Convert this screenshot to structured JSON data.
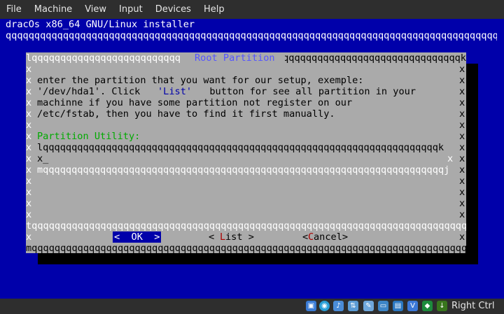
{
  "menu": {
    "items": [
      "File",
      "Machine",
      "View",
      "Input",
      "Devices",
      "Help"
    ]
  },
  "installer": {
    "backtitle": "dracOs x86_64 GNU/Linux installer",
    "rule": "qqqqqqqqqqqqqqqqqqqqqqqqqqqqqqqqqqqqqqqqqqqqqqqqqqqqqqqqqqqqqqqqqqqqqqqqqqqqqqqqqqqqqqqqqqqqq"
  },
  "dialog": {
    "title": "Root Partition",
    "border_top_left": "lqqqqqqqqqqqqqqqqqqqqqqqqqq",
    "border_top_right": "qqqqqqqqqqqqqqqqqqqqqqqqqqqqqqqqqqqqqqqqqqqqqqqqqqqqqqqqqqqqqqqqqqqqqqk",
    "side": "x",
    "message": [
      "enter the partition that you want for our setup, exemple:",
      "'/dev/hda1'. Click ",
      "machinne if you have some partition not register on our",
      "/etc/fstab, then you have to find it first manually."
    ],
    "list_word": "'List'",
    "message_line2_tail": "  button for see all partition in your",
    "section_label": "Partition Utility:",
    "input_top": "lqqqqqqqqqqqqqqqqqqqqqqqqqqqqqqqqqqqqqqqqqqqqqqqqqqqqqqqqqqqqqqqqqqqqqk",
    "input_value": "x_",
    "input_bottom": "mqqqqqqqqqqqqqqqqqqqqqqqqqqqqqqqqqqqqqqqqqqqqqqqqqqqqqqqqqqqqqqqqqqqqqqj",
    "separator": "tqqqqqqqqqqqqqqqqqqqqqqqqqqqqqqqqqqqqqqqqqqqqqqqqqqqqqqqqqqqqqqqqqqqqqqqqqqqqqqqqqqqqqqqqqqqu",
    "border_bottom": "mqqqqqqqqqqqqqqqqqqqqqqqqqqqqqqqqqqqqqqqqqqqqqqqqqqqqqqqqqqqqqqqqqqqqqqqqqqqqqqqqqqqqqqqqqqqj",
    "buttons": {
      "ok": "<  OK  >",
      "list_left": "< ",
      "list_hot": "L",
      "list_rest": "ist >",
      "cancel_left": "<",
      "cancel_hot": "C",
      "cancel_rest": "ancel>"
    }
  },
  "statusbar": {
    "host_key": "Right Ctrl"
  },
  "colors": {
    "screen": "#0000aa",
    "dialog": "#aaaaaa",
    "title": "#5555ff",
    "section": "#00aa00",
    "hotkey": "#aa0000",
    "button_selected_bg": "#0000aa",
    "border_light": "#ffffff"
  }
}
